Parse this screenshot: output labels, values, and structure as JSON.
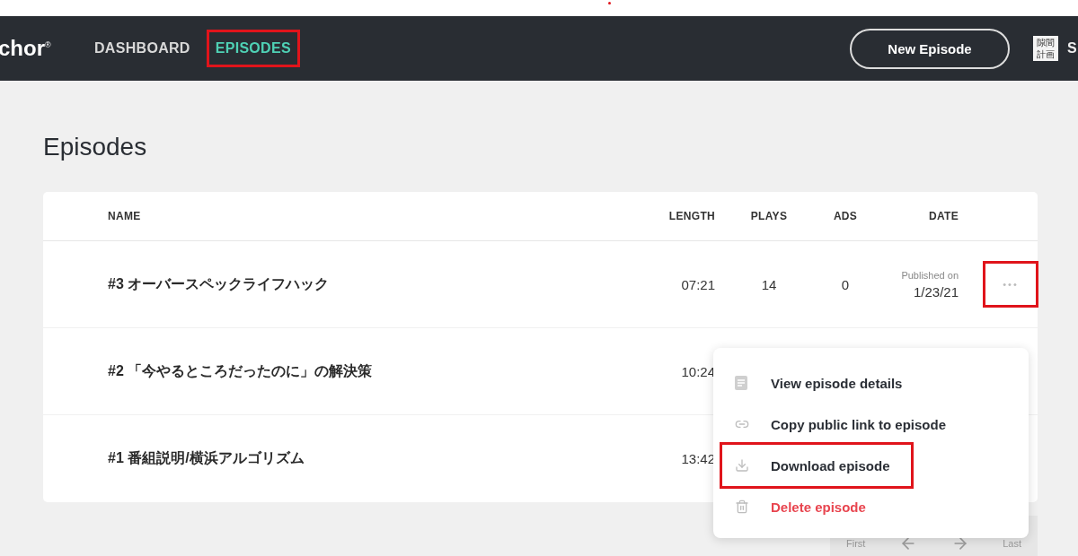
{
  "header": {
    "logo": "chor$^{®}$",
    "nav": [
      {
        "label": "DASHBOARD",
        "selected": false,
        "highlighted": false
      },
      {
        "label": "EPISODES",
        "selected": true,
        "highlighted": true
      }
    ],
    "new_episode_button": "New Episode",
    "account": {
      "badge": [
        "隙間",
        "計画"
      ],
      "name": "S"
    }
  },
  "page_title": "Episodes",
  "table": {
    "columns": [
      "NAME",
      "LENGTH",
      "PLAYS",
      "ADS",
      "DATE"
    ],
    "rows": [
      {
        "title": "#3 オーバースペックライフハック",
        "length": "07:21",
        "plays": "14",
        "ads": "0",
        "date_caption": "Published on",
        "date": "1/23/21",
        "more": "•••",
        "more_highlighted": true
      },
      {
        "title": "#2 「今やるところだったのに」の解決策",
        "length": "10:24"
      },
      {
        "title": "#1 番組説明/横浜アルゴリズム",
        "length": "13:42"
      }
    ]
  },
  "menu": {
    "items": [
      {
        "label": "View episode details",
        "kind": "details",
        "highlighted": false
      },
      {
        "label": "Copy public link to episode",
        "kind": "link",
        "highlighted": false
      },
      {
        "label": "Download episode",
        "kind": "download",
        "highlighted": true
      },
      {
        "label": "Delete episode",
        "kind": "delete",
        "highlighted": false
      }
    ]
  },
  "pagination": {
    "first": "First",
    "last": "Last"
  }
}
